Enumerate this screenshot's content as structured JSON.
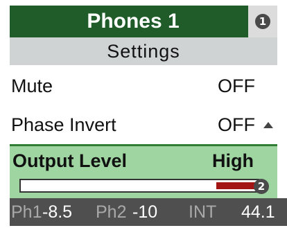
{
  "header": {
    "title": "Phones 1",
    "badge": "1"
  },
  "subheader": {
    "title": "Settings"
  },
  "rows": [
    {
      "label": "Mute",
      "value": "OFF"
    },
    {
      "label": "Phase Invert",
      "value": "OFF"
    }
  ],
  "level": {
    "label": "Output Level",
    "value": "High",
    "fill_fraction": 0.17,
    "badge": "2"
  },
  "status": {
    "ph1_label": "Ph1",
    "ph1_value": "-8.5",
    "ph2_label": "Ph2",
    "ph2_value": "-10",
    "clock_label": "INT",
    "clock_value": "44.1"
  },
  "colors": {
    "header_bg": "#1f5c29",
    "selected_bg": "#9fd5a0",
    "meter_fill": "#a31515",
    "status_bg": "#4f4f4f"
  },
  "icons": {
    "scroll_indicator": "triangle-up-icon"
  }
}
